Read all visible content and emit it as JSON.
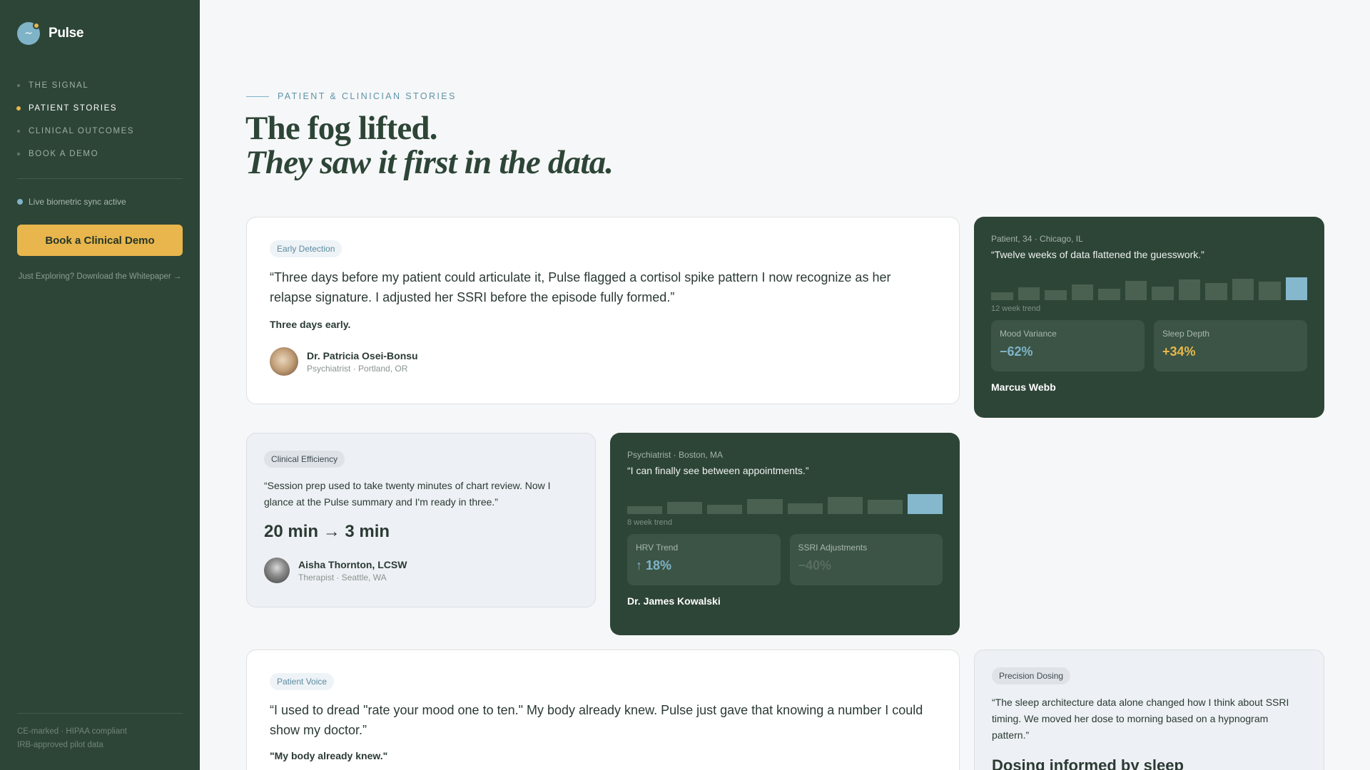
{
  "brand": {
    "name": "Pulse"
  },
  "nav": [
    {
      "label": "THE SIGNAL",
      "active": false
    },
    {
      "label": "PATIENT STORIES",
      "active": true
    },
    {
      "label": "CLINICAL OUTCOMES",
      "active": false
    },
    {
      "label": "BOOK A DEMO",
      "active": false
    }
  ],
  "sidebar": {
    "sync_status": "Live biometric sync active",
    "demo_button": "Book a Clinical Demo",
    "whitepaper_link": "Just Exploring? Download the Whitepaper →",
    "compliance_line1": "CE-marked · HIPAA compliant",
    "compliance_line2": "IRB-approved pilot data"
  },
  "header": {
    "eyebrow": "PATIENT & CLINICIAN STORIES",
    "headline_line1": "The fog lifted.",
    "headline_line2": "They saw it first in the data."
  },
  "cards": {
    "early": {
      "tag": "Early Detection",
      "quote": "“Three days before my patient could articulate it, Pulse flagged a cortisol spike pattern I now recognize as her relapse signature. I adjusted her SSRI before the episode fully formed.”",
      "highlight": "Three days early.",
      "name": "Dr. Patricia Osei-Bonsu",
      "role": "Psychiatrist · Portland, OR"
    },
    "marcus": {
      "meta": "Patient, 34 · Chicago, IL",
      "quote": "“Twelve weeks of data flattened the guesswork.”",
      "trend_label": "12 week trend",
      "bars": [
        0.35,
        0.55,
        0.45,
        0.7,
        0.5,
        0.85,
        0.6,
        0.9,
        0.75,
        0.95,
        0.8,
        1.0
      ],
      "stat1_label": "Mood Variance",
      "stat1_value": "−62%",
      "stat1_color": "#7fb3c8",
      "stat2_label": "Sleep Depth",
      "stat2_value": "+34%",
      "stat2_color": "#e7b74a",
      "name": "Marcus Webb"
    },
    "efficiency": {
      "tag": "Clinical Efficiency",
      "quote": "“Session prep used to take twenty minutes of chart review. Now I glance at the Pulse summary and I'm ready in three.”",
      "metric": "20 min → 3 min",
      "name": "Aisha Thornton, LCSW",
      "role": "Therapist · Seattle, WA"
    },
    "james": {
      "meta": "Psychiatrist · Boston, MA",
      "quote": "“I can finally see between appointments.”",
      "trend_label": "8 week trend",
      "bars": [
        0.4,
        0.6,
        0.45,
        0.75,
        0.55,
        0.85,
        0.7,
        1.0
      ],
      "stat1_label": "HRV Trend",
      "stat1_value": "↑ 18%",
      "stat1_color": "#7fb3c8",
      "stat2_label": "SSRI Adjustments",
      "stat2_value": "−40%",
      "stat2_color": "#586c60",
      "name": "Dr. James Kowalski"
    },
    "voice": {
      "tag": "Patient Voice",
      "quote": "“I used to dread \"rate your mood one to ten.\" My body already knew. Pulse just gave that knowing a number I could show my doctor.”",
      "highlight": "\"My body already knew.\""
    },
    "dosing": {
      "tag": "Precision Dosing",
      "quote": "“The sleep architecture data alone changed how I think about SSRI timing. We moved her dose to morning based on a hypnogram pattern.”",
      "metric": "Dosing informed by sleep"
    }
  },
  "colors": {
    "sidebar": "#2d4537",
    "accent_gold": "#e8b64c",
    "accent_blue": "#7fb3c8"
  },
  "icons": [
    "pulse-logo-icon",
    "nav-bullet-icon",
    "sync-dot-icon"
  ]
}
